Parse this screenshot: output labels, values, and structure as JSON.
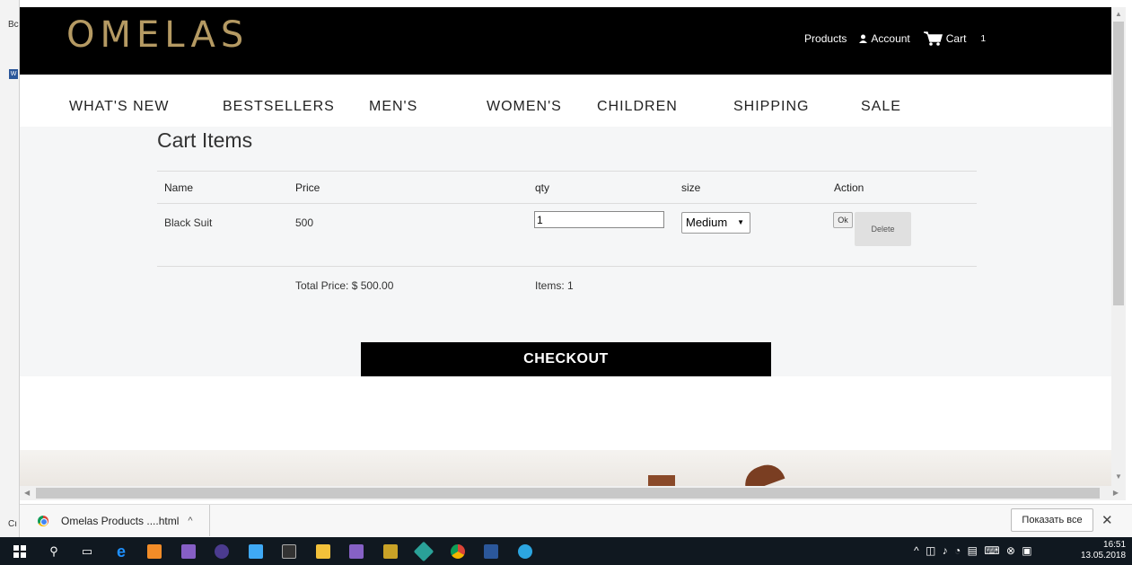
{
  "left_strip": {
    "top_text": "Bc",
    "bottom_text": "Cı",
    "icon_label": "W"
  },
  "header": {
    "logo": "OMELAS",
    "nav": {
      "products": "Products",
      "account": "Account",
      "cart": "Cart",
      "cart_count": "1"
    }
  },
  "main_nav": [
    "WHAT'S NEW",
    "BESTSELLERS",
    "MEN'S",
    "WOMEN'S",
    "CHILDREN",
    "SHIPPING",
    "SALE"
  ],
  "cart": {
    "title": "Cart Items",
    "columns": [
      "Name",
      "Price",
      "qty",
      "size",
      "Action"
    ],
    "rows": [
      {
        "name": "Black Suit",
        "price": "500",
        "qty": "1",
        "size": "Medium",
        "ok_label": "Ok",
        "delete_label": "Delete"
      }
    ],
    "total_price": "Total Price: $ 500.00",
    "items_count": "Items: 1",
    "checkout_label": "CHECKOUT"
  },
  "downloads": {
    "file": "Omelas Products ....html",
    "show_all": "Показать все",
    "close": "✕"
  },
  "taskbar": {
    "time": "16:51",
    "date": "13.05.2018"
  }
}
